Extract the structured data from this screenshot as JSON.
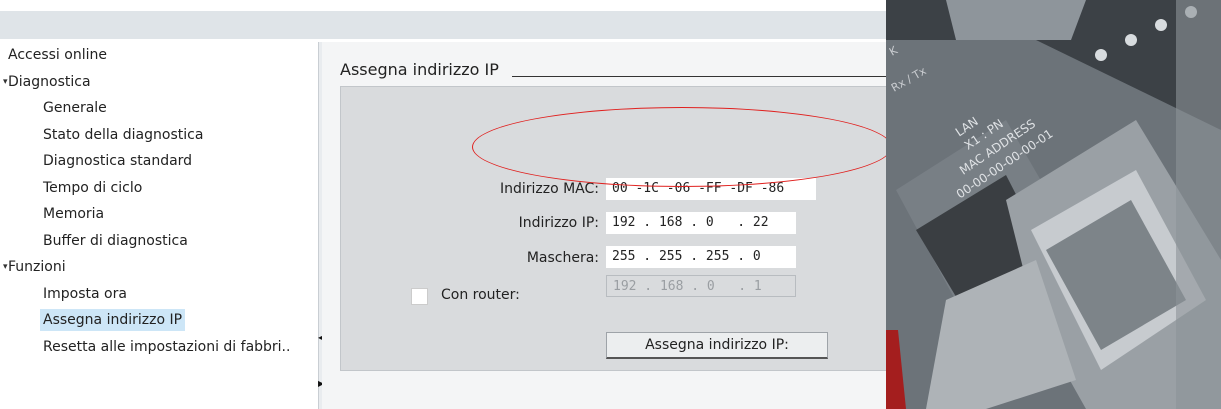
{
  "tree": {
    "items": [
      {
        "label": "Accessi online",
        "level": 0,
        "expander": ""
      },
      {
        "label": "Diagnostica",
        "level": 0,
        "expander": "▾"
      },
      {
        "label": "Generale",
        "level": 1,
        "expander": ""
      },
      {
        "label": "Stato della diagnostica",
        "level": 1,
        "expander": ""
      },
      {
        "label": "Diagnostica standard",
        "level": 1,
        "expander": ""
      },
      {
        "label": "Tempo di ciclo",
        "level": 1,
        "expander": ""
      },
      {
        "label": "Memoria",
        "level": 1,
        "expander": ""
      },
      {
        "label": "Buffer di diagnostica",
        "level": 1,
        "expander": ""
      },
      {
        "label": "Funzioni",
        "level": 0,
        "expander": "▾"
      },
      {
        "label": "Imposta ora",
        "level": 1,
        "expander": ""
      },
      {
        "label": "Assegna indirizzo IP",
        "level": 1,
        "expander": "",
        "selected": true
      },
      {
        "label": "Resetta alle impostazioni di fabbri..",
        "level": 1,
        "expander": ""
      }
    ]
  },
  "panel": {
    "section_title": "Assegna indirizzo IP",
    "mac_label": "Indirizzo MAC:",
    "mac_value": "00 -1C -06 -FF -DF -86",
    "ip_label": "Indirizzo IP:",
    "ip_value": "192 . 168 . 0   . 22",
    "mask_label": "Maschera:",
    "mask_value": "255 . 255 . 255 . 0",
    "router_label": "Con router:",
    "router_checked": false,
    "router_value": "192 . 168 . 0   . 1",
    "assign_button": "Assegna indirizzo IP:"
  },
  "photo": {
    "line1": "LAN",
    "line2": "X1 : PN",
    "line3": "MAC ADDRESS",
    "line4": "00-00-00-00-00-01",
    "corner_label": "Rx / Tx",
    "corner_k": "K"
  },
  "colors": {
    "highlight_ellipse": "#e0201e",
    "selected_bg": "#cde6f7",
    "group_bg": "#d9dbdd"
  }
}
